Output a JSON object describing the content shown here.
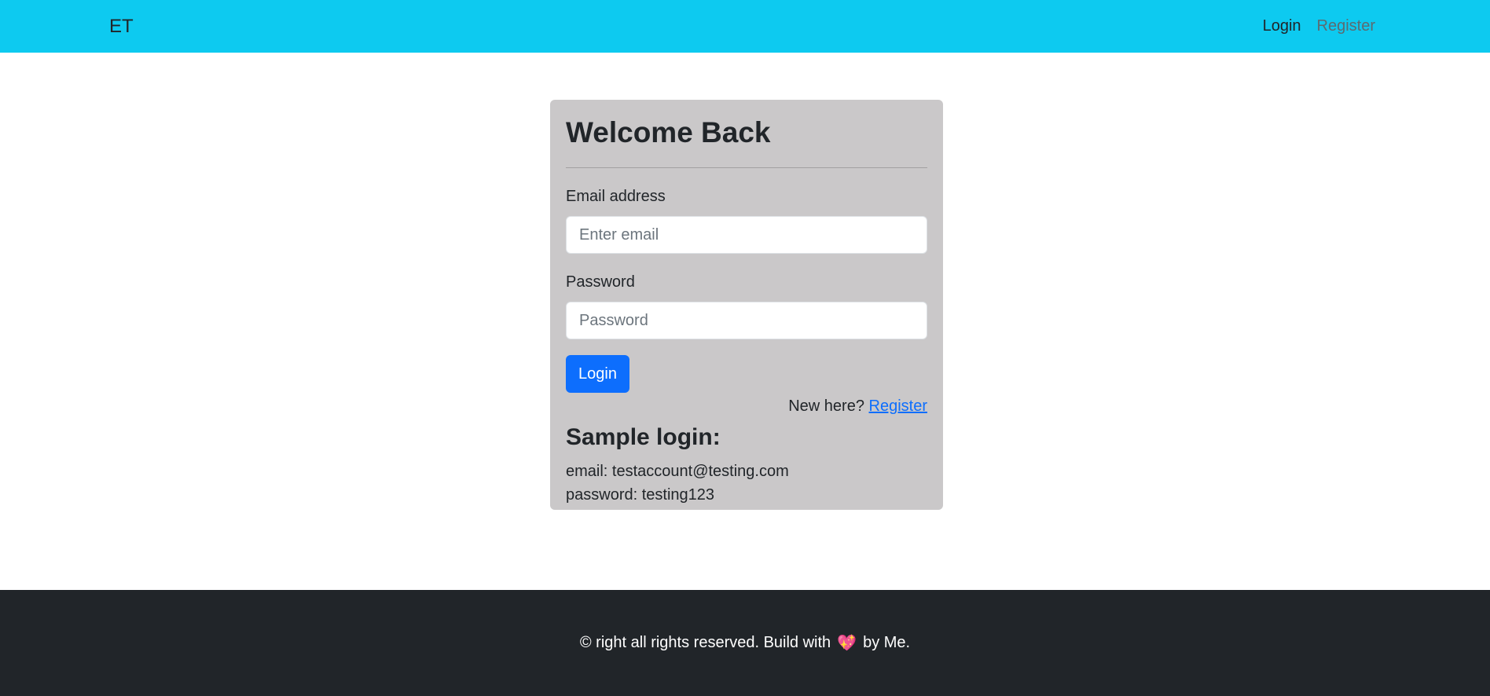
{
  "navbar": {
    "brand": "ET",
    "links": [
      {
        "label": "Login"
      },
      {
        "label": "Register"
      }
    ]
  },
  "card": {
    "title": "Welcome Back",
    "email_label": "Email address",
    "email_placeholder": "Enter email",
    "password_label": "Password",
    "password_placeholder": "Password",
    "login_button": "Login",
    "signup_prompt": "New here?",
    "signup_link": "Register",
    "sample_title": "Sample login:",
    "sample_email": "email: testaccount@testing.com",
    "sample_password": "password: testing123"
  },
  "footer": {
    "text_before": "© right all rights reserved. Build with",
    "heart_icon": "heart-icon",
    "text_after": "by Me."
  },
  "colors": {
    "navbar": "#0dcaf0",
    "card": "#cac8c9",
    "primary": "#0d6efd",
    "footer": "#212529"
  }
}
